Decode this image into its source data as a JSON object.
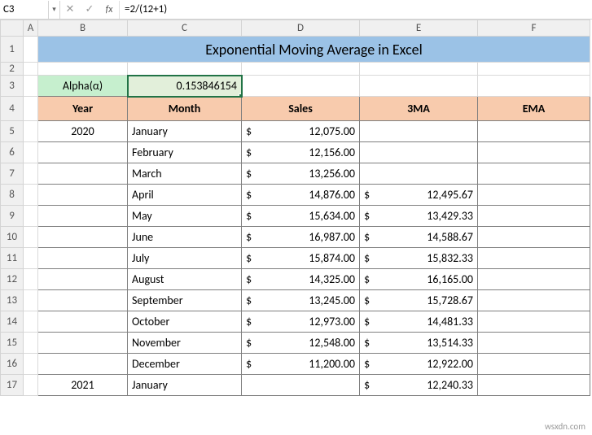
{
  "formulaBar": {
    "nameBox": "C3",
    "formula": "=2/(12+1)"
  },
  "fx": "fx",
  "title": "Exponential Moving Average in Excel",
  "alpha": {
    "label": "Alpha(α)",
    "value": "0.153846154"
  },
  "headers": {
    "year": "Year",
    "month": "Month",
    "sales": "Sales",
    "ma3": "3MA",
    "ema": "EMA"
  },
  "colHeaders": [
    "A",
    "B",
    "C",
    "D",
    "E",
    "F"
  ],
  "rowHeaders": [
    "1",
    "2",
    "3",
    "4",
    "5",
    "6",
    "7",
    "8",
    "9",
    "10",
    "11",
    "12",
    "13",
    "14",
    "15",
    "16",
    "17"
  ],
  "rows": [
    {
      "year": "2020",
      "month": "January",
      "sales": "12,075.00",
      "ma3": "",
      "ema": ""
    },
    {
      "year": "",
      "month": "February",
      "sales": "12,156.00",
      "ma3": "",
      "ema": ""
    },
    {
      "year": "",
      "month": "March",
      "sales": "13,256.00",
      "ma3": "",
      "ema": ""
    },
    {
      "year": "",
      "month": "April",
      "sales": "14,876.00",
      "ma3": "12,495.67",
      "ema": ""
    },
    {
      "year": "",
      "month": "May",
      "sales": "15,634.00",
      "ma3": "13,429.33",
      "ema": ""
    },
    {
      "year": "",
      "month": "June",
      "sales": "16,987.00",
      "ma3": "14,588.67",
      "ema": ""
    },
    {
      "year": "",
      "month": "July",
      "sales": "15,874.00",
      "ma3": "15,832.33",
      "ema": ""
    },
    {
      "year": "",
      "month": "August",
      "sales": "14,325.00",
      "ma3": "16,165.00",
      "ema": ""
    },
    {
      "year": "",
      "month": "September",
      "sales": "13,245.00",
      "ma3": "15,728.67",
      "ema": ""
    },
    {
      "year": "",
      "month": "October",
      "sales": "12,973.00",
      "ma3": "14,481.33",
      "ema": ""
    },
    {
      "year": "",
      "month": "November",
      "sales": "12,548.00",
      "ma3": "13,514.33",
      "ema": ""
    },
    {
      "year": "",
      "month": "December",
      "sales": "11,200.00",
      "ma3": "12,922.00",
      "ema": ""
    },
    {
      "year": "2021",
      "month": "January",
      "sales": "",
      "ma3": "12,240.33",
      "ema": ""
    }
  ],
  "currencySymbol": "$",
  "watermark": "wsxdn.com",
  "icons": {
    "dropdown": "▾",
    "cancel": "✕",
    "confirm": "✓"
  }
}
